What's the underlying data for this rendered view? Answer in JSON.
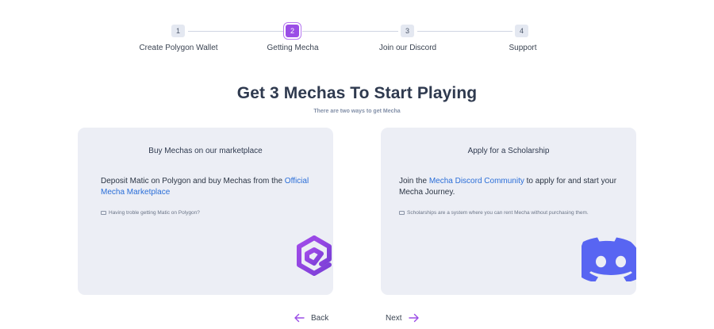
{
  "stepper": {
    "steps": [
      {
        "number": "1",
        "label": "Create Polygon Wallet",
        "active": false
      },
      {
        "number": "2",
        "label": "Getting Mecha",
        "active": true
      },
      {
        "number": "3",
        "label": "Join our Discord",
        "active": false
      },
      {
        "number": "4",
        "label": "Support",
        "active": false
      }
    ]
  },
  "header": {
    "title": "Get 3 Mechas To Start Playing",
    "subtitle": "There are two ways to get Mecha"
  },
  "cards": {
    "marketplace": {
      "title": "Buy Mechas on our marketplace",
      "body_prefix": "Deposit Matic on Polygon and buy Mechas from the ",
      "link_text": "Official Mecha Marketplace",
      "note": "Having troble getting Matic on Polygon?",
      "logo_icon": "mecha-logo-icon"
    },
    "scholarship": {
      "title": "Apply for a Scholarship",
      "body_prefix": "Join the ",
      "link_text": "Mecha Discord Community",
      "body_suffix": " to apply for and start your Mecha Journey.",
      "note": "Scholarships are a system where you can rent Mecha without purchasing them.",
      "logo_icon": "discord-logo-icon"
    }
  },
  "nav": {
    "back_label": "Back",
    "next_label": "Next"
  },
  "colors": {
    "accent": "#9b4ee6",
    "link": "#2a6ed8",
    "card_bg": "#eceef5",
    "discord": "#5865f2"
  }
}
